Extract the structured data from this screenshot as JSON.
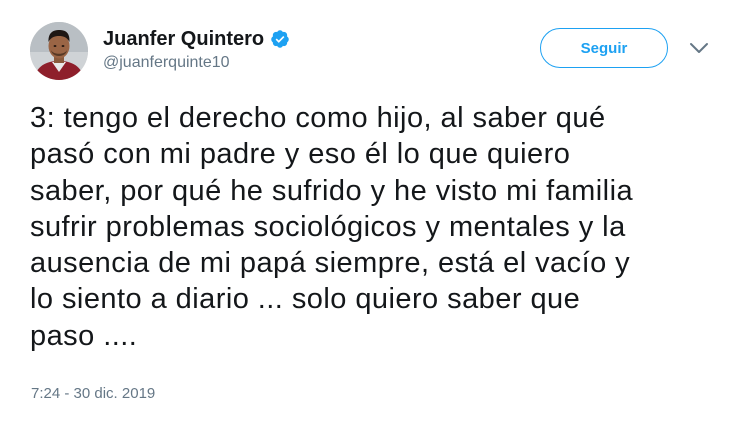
{
  "tweet": {
    "author": {
      "display_name": "Juanfer Quintero",
      "handle": "@juanferquinte10",
      "verified_icon": "verified-badge-icon"
    },
    "follow_label": "Seguir",
    "more_icon": "chevron-down-icon",
    "text": "3: tengo el derecho como hijo, al saber qué\npasó con mi padre y eso él lo que quiero\nsaber, por qué he sufrido y he visto mi familia\nsufrir problemas sociológicos y mentales y la\nausencia de mi papá siempre, está el vacío y\nlo siento a diario ... solo quiero saber que\npaso ....",
    "timestamp": "7:24 - 30 dic. 2019"
  },
  "colors": {
    "accent": "#1da1f2",
    "text_primary": "#14171a",
    "text_secondary": "#657786"
  }
}
